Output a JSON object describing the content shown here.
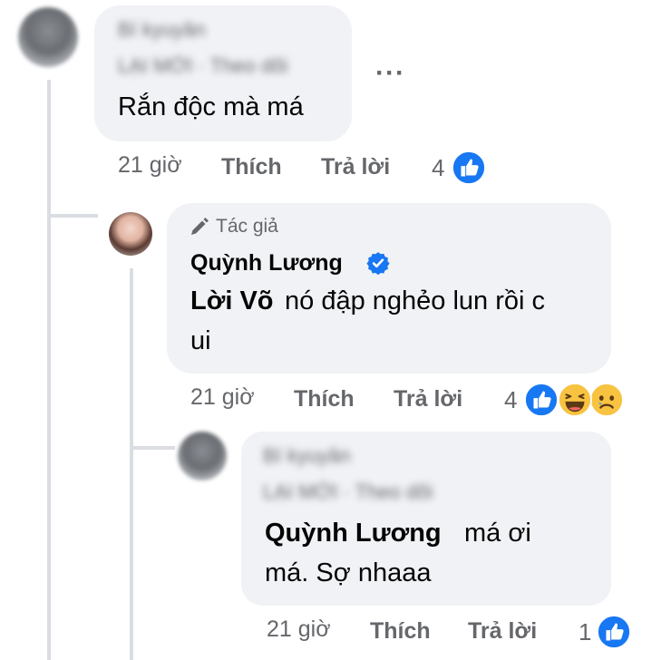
{
  "comment1": {
    "author_blurred": "Bí kyuyân",
    "subline_blurred": "LẠI MỚI · Theo dõi",
    "text": "Rắn độc mà má",
    "time": "21 giờ",
    "like": "Thích",
    "reply": "Trả lời",
    "reaction_count": "4",
    "more": "···"
  },
  "reply1": {
    "badge": "Tác giả",
    "author": "Quỳnh Lương",
    "mention": "Lời Võ",
    "text_line1": "nó đập nghẻo lun rồi c",
    "text_line2": "ui",
    "time": "21 giờ",
    "like": "Thích",
    "reply": "Trả lời",
    "reaction_count": "4"
  },
  "reply2": {
    "author_blurred": "Bí kyuyân",
    "subline_blurred": "LẠI MỚI · Theo dõi",
    "mention": "Quỳnh Lương",
    "text_line1": "má ơi",
    "text_line2": "má. Sợ nhaaa",
    "time": "21 giờ",
    "like": "Thích",
    "reply": "Trả lời",
    "reaction_count": "1"
  },
  "colors": {
    "bubble": "#f0f2f5",
    "meta": "#65676b",
    "like_blue": "#1877f2",
    "verified": "#1877f2"
  },
  "icons": [
    "like-reaction-icon",
    "haha-reaction-icon",
    "sad-reaction-icon",
    "verified-badge-icon",
    "author-pen-icon",
    "more-options-icon"
  ]
}
